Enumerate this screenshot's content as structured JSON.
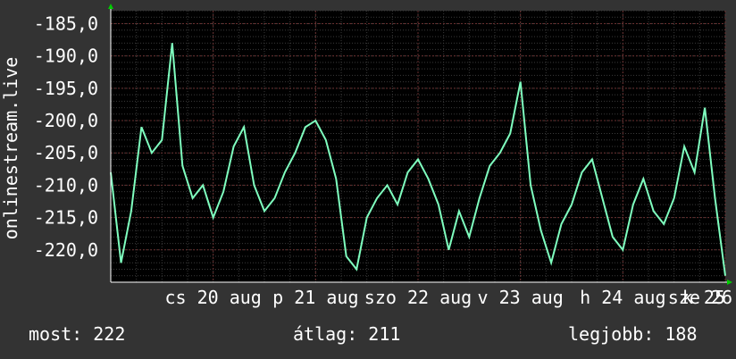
{
  "chart_data": {
    "type": "line",
    "ylabel": "onlinestream.live",
    "ylim": [
      -225.0,
      -183.0
    ],
    "yticks": [
      "-185,0",
      "-190,0",
      "-195,0",
      "-200,0",
      "-205,0",
      "-210,0",
      "-215,0",
      "-220,0"
    ],
    "ytick_values": [
      -185,
      -190,
      -195,
      -200,
      -205,
      -210,
      -215,
      -220
    ],
    "xlim": [
      0,
      6
    ],
    "xtick_labels": [
      "cs 20 aug",
      "p 21 aug",
      "szo 22 aug",
      "v 23 aug",
      "h 24 aug",
      "k 25 aug",
      "sze 26"
    ],
    "grid": true,
    "series": [
      {
        "color": "#7fffbf",
        "x": [
          0.0,
          0.1,
          0.2,
          0.3,
          0.4,
          0.5,
          0.6,
          0.7,
          0.8,
          0.9,
          1.0,
          1.1,
          1.2,
          1.3,
          1.4,
          1.5,
          1.6,
          1.7,
          1.8,
          1.9,
          2.0,
          2.1,
          2.2,
          2.3,
          2.4,
          2.5,
          2.6,
          2.7,
          2.8,
          2.9,
          3.0,
          3.1,
          3.2,
          3.3,
          3.4,
          3.5,
          3.6,
          3.7,
          3.8,
          3.9,
          4.0,
          4.1,
          4.2,
          4.3,
          4.4,
          4.5,
          4.6,
          4.7,
          4.8,
          4.9,
          5.0,
          5.1,
          5.2,
          5.3,
          5.4,
          5.5,
          5.6,
          5.7,
          5.8,
          5.9,
          6.0
        ],
        "values": [
          -208,
          -222,
          -214,
          -201,
          -205,
          -203,
          -188,
          -207,
          -212,
          -210,
          -215,
          -211,
          -204,
          -201,
          -210,
          -214,
          -212,
          -208,
          -205,
          -201,
          -200,
          -203,
          -209,
          -221,
          -223,
          -215,
          -212,
          -210,
          -213,
          -208,
          -206,
          -209,
          -213,
          -220,
          -214,
          -218,
          -212,
          -207,
          -205,
          -202,
          -194,
          -210,
          -217,
          -222,
          -216,
          -213,
          -208,
          -206,
          -212,
          -218,
          -220,
          -213,
          -209,
          -214,
          -216,
          -212,
          -204,
          -208,
          -198,
          -212,
          -224
        ]
      }
    ],
    "stats": {
      "now_label": "most:",
      "now": "222",
      "avg_label": "átlag:",
      "avg": "211",
      "best_label": "legjobb:",
      "best": "188"
    }
  }
}
